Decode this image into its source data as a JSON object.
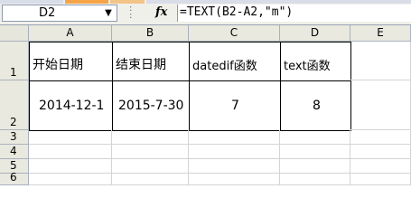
{
  "formula_bar": {
    "name_box": "D2",
    "fx_symbol": "fx",
    "formula": "=TEXT(B2-A2,\"m\")"
  },
  "columns": [
    "A",
    "B",
    "C",
    "D",
    "E"
  ],
  "rows": [
    "1",
    "2",
    "3",
    "4",
    "5",
    "6"
  ],
  "cells": {
    "A1": "开始日期",
    "B1": "结束日期",
    "C1": "datedif函数",
    "D1": "text函数",
    "A2": "2014-12-1",
    "B2": "2015-7-30",
    "C2": "7",
    "D2": "8"
  }
}
